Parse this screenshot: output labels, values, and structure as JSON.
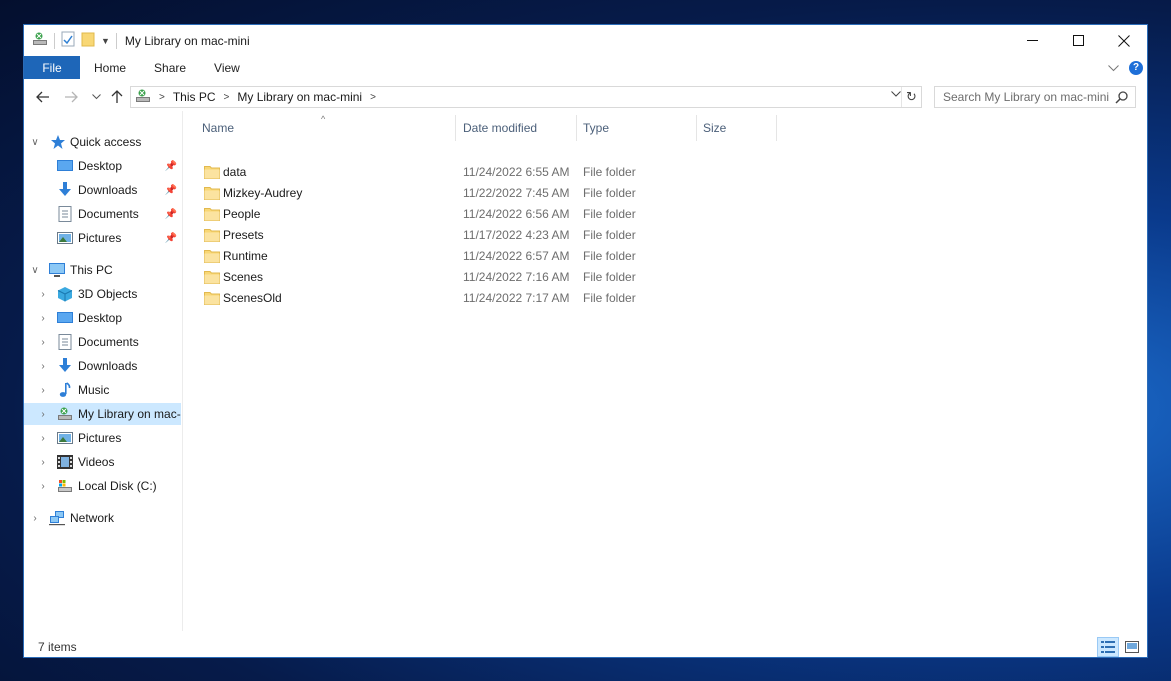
{
  "window": {
    "title": "My Library on mac-mini"
  },
  "ribbon": {
    "tabs": [
      {
        "label": "File"
      },
      {
        "label": "Home"
      },
      {
        "label": "Share"
      },
      {
        "label": "View"
      }
    ]
  },
  "address": {
    "crumbs": [
      "This PC",
      "My Library on mac-mini"
    ]
  },
  "search": {
    "placeholder": "Search My Library on mac-mini"
  },
  "nav": {
    "quick_access": {
      "label": "Quick access",
      "items": [
        {
          "label": "Desktop",
          "icon": "desktop-icon"
        },
        {
          "label": "Downloads",
          "icon": "downloads-icon"
        },
        {
          "label": "Documents",
          "icon": "documents-icon"
        },
        {
          "label": "Pictures",
          "icon": "pictures-icon"
        }
      ]
    },
    "this_pc": {
      "label": "This PC",
      "items": [
        {
          "label": "3D Objects",
          "icon": "3d-objects-icon"
        },
        {
          "label": "Desktop",
          "icon": "desktop-icon"
        },
        {
          "label": "Documents",
          "icon": "documents-icon"
        },
        {
          "label": "Downloads",
          "icon": "downloads-icon"
        },
        {
          "label": "Music",
          "icon": "music-icon"
        },
        {
          "label": "My Library on mac-",
          "icon": "network-drive-icon"
        },
        {
          "label": "Pictures",
          "icon": "pictures-icon"
        },
        {
          "label": "Videos",
          "icon": "videos-icon"
        },
        {
          "label": "Local Disk (C:)",
          "icon": "local-disk-icon"
        }
      ]
    },
    "network": {
      "label": "Network"
    }
  },
  "columns": {
    "name": "Name",
    "date": "Date modified",
    "type": "Type",
    "size": "Size"
  },
  "files": [
    {
      "name": "data",
      "date": "11/24/2022 6:55 AM",
      "type": "File folder"
    },
    {
      "name": "Mizkey-Audrey",
      "date": "11/22/2022 7:45 AM",
      "type": "File folder"
    },
    {
      "name": "People",
      "date": "11/24/2022 6:56 AM",
      "type": "File folder"
    },
    {
      "name": "Presets",
      "date": "11/17/2022 4:23 AM",
      "type": "File folder"
    },
    {
      "name": "Runtime",
      "date": "11/24/2022 6:57 AM",
      "type": "File folder"
    },
    {
      "name": "Scenes",
      "date": "11/24/2022 7:16 AM",
      "type": "File folder"
    },
    {
      "name": "ScenesOld",
      "date": "11/24/2022 7:17 AM",
      "type": "File folder"
    }
  ],
  "status": {
    "item_count": "7 items"
  },
  "colors": {
    "accent": "#1e66b8",
    "selection": "#cce8ff",
    "folder": "#f8d775"
  }
}
